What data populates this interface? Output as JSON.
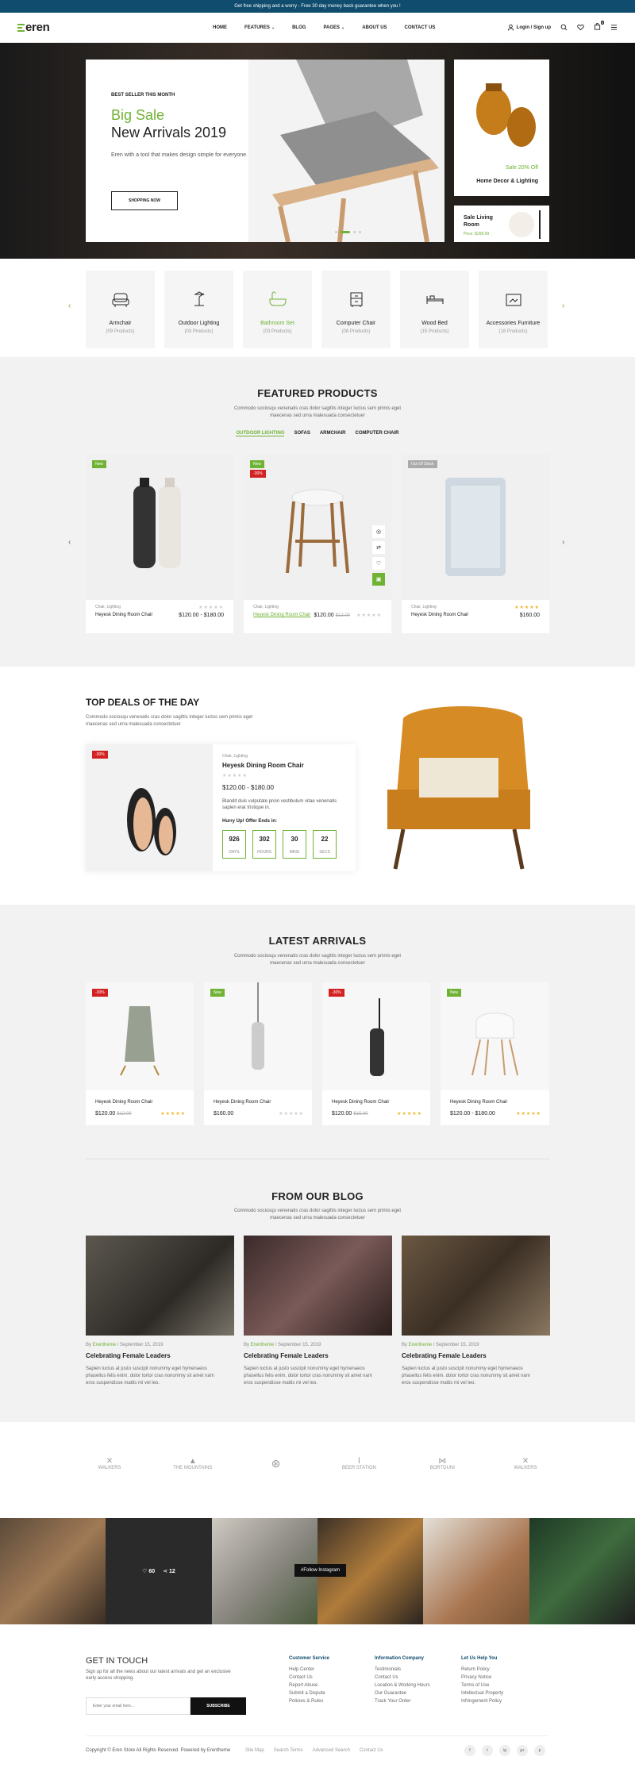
{
  "topbar": {
    "text": "Get free shipping and a worry - Free 30 day money back guarantee when you !"
  },
  "header": {
    "logo": "eren",
    "nav": [
      "HOME",
      "FEATURES",
      "BLOG",
      "PAGES",
      "ABOUT US",
      "CONTACT US"
    ],
    "login": "Login / Sign up",
    "cart_count": "0"
  },
  "hero": {
    "kicker": "BEST SELLER THIS MONTH",
    "title_green": "Big Sale",
    "title_dark": "New Arrivals 2019",
    "desc": "Eren with a tool that makes design simple for everyone.",
    "button": "SHOPPING NOW",
    "side1_sale": "Sale 20% Off",
    "side1_title": "Home Decor & Lighting",
    "side2_title": "Sale Living Room",
    "side2_price": "Price: $299.99"
  },
  "categories": [
    {
      "name": "Armchair",
      "count": "(09 Products)"
    },
    {
      "name": "Outdoor Lighting",
      "count": "(03 Products)"
    },
    {
      "name": "Bathroom Set",
      "count": "(03 Products)"
    },
    {
      "name": "Computer Chair",
      "count": "(08 Products)"
    },
    {
      "name": "Wood Bed",
      "count": "(15 Products)"
    },
    {
      "name": "Accessories Furniture",
      "count": "(18 Products)"
    }
  ],
  "featured": {
    "title": "FEATURED PRODUCTS",
    "desc1": "Commodo sociosqu venenatis cras dolor sagittis integer luctus sem primis eget",
    "desc2": "maecenas sed urna malesuada consectetuer",
    "tabs": [
      "OUTDOOR LIGHTING",
      "SOFAS",
      "ARMCHAIR",
      "COMPUTER CHAIR"
    ],
    "products": [
      {
        "badge": "New",
        "cat": "Chair, Lighting",
        "name": "Heyesk Dining Room Chair",
        "price": "$120.00 - $180.00",
        "old": ""
      },
      {
        "badge": "New",
        "badge2": "-30%",
        "cat": "Chair, Lighting",
        "name": "Heyesk Dining Room Chair",
        "price": "$120.00",
        "old": "$12.00"
      },
      {
        "badge": "Out Of Stock",
        "cat": "Chair, Lighting",
        "name": "Heyesk Dining Room Chair",
        "price": "$160.00",
        "old": ""
      }
    ]
  },
  "deal": {
    "title": "TOP DEALS OF THE DAY",
    "desc1": "Commodo sociosqu venenatis cras dolor sagittis integer luctus sem primis eget",
    "desc2": "maecenas sed urna malesuada consectetuer",
    "badge": "-30%",
    "cat": "Chair, Lighting",
    "name": "Heyesk Dining Room Chair",
    "price": "$120.00 - $180.00",
    "text1": "Blandit duis vulputate proin vestibulum vitae venenatis",
    "text2": "sapien erat tristique in.",
    "hurry": "Hurry Up! Offer Ends in:",
    "cd": [
      {
        "v": "926",
        "l": "DAYS"
      },
      {
        "v": "302",
        "l": "HOURS"
      },
      {
        "v": "30",
        "l": "MINS"
      },
      {
        "v": "22",
        "l": "SECS"
      }
    ]
  },
  "latest": {
    "title": "LATEST ARRIVALS",
    "desc1": "Commodo sociosqu venenatis cras dolor sagittis integer luctus sem primis eget",
    "desc2": "maecenas sed urna malesuada consectetuer",
    "products": [
      {
        "badge": "-30%",
        "name": "Heyesk Dining Room Chair",
        "price": "$120.00",
        "old": "$12.00"
      },
      {
        "badge": "New",
        "name": "Heyesk Dining Room Chair",
        "price": "$160.00",
        "old": ""
      },
      {
        "badge": "-30%",
        "name": "Heyesk Dining Room Chair",
        "price": "$120.00",
        "old": "$15.00"
      },
      {
        "badge": "New",
        "name": "Heyesk Dining Room Chair",
        "price": "$120.00 - $180.00",
        "old": ""
      }
    ]
  },
  "blog": {
    "title": "FROM OUR BLOG",
    "desc1": "Commodo sociosqu venenatis cras dolor sagittis integer luctus sem primis eget",
    "desc2": "maecenas sed urna malesuada consectetuer",
    "by": "By",
    "author": "Erentheme",
    "date": "/ September 15, 2019",
    "post_title": "Celebrating Female Leaders",
    "excerpt1": "Sapien luctus at justo suscipit nonummy eget hymenaeos",
    "excerpt2": "phasellus felis enim. dolor tortor cras nonummy sit amet nam",
    "excerpt3": "eros suspendisse mattis mi vel leo."
  },
  "brands": [
    "WALKERS",
    "THE MOUNTAINS",
    "",
    "BEER STATION",
    "BORTOUNI",
    "WALKERS"
  ],
  "insta": {
    "likes": "60",
    "shares": "12",
    "button": "#Follow Instagram"
  },
  "footer": {
    "get_title": "GET IN TOUCH",
    "get_text1": "Sign up for all the news about our latest arrivals and get an exclusive",
    "get_text2": "early access shopping.",
    "email_ph": "Enter your email here...",
    "subscribe": "SUBSCRIBE",
    "cols": [
      {
        "title": "Customer Service",
        "items": [
          "Help Center",
          "Contact Us",
          "Report Abuse",
          "Submit a Dispute",
          "Policies & Rules"
        ]
      },
      {
        "title": "Information Company",
        "items": [
          "Testimonials",
          "Contact Us",
          "Location & Working Hours",
          "Our Guarantee",
          "Track Your Order"
        ]
      },
      {
        "title": "Let Us Help You",
        "items": [
          "Return Policy",
          "Privacy Notice",
          "Terms of Use",
          "Intellectual Property",
          "Infringement Policy"
        ]
      }
    ],
    "copyright": "Copyright © Eren Store All Rights Reserved. Powered by Erentheme",
    "links": [
      "Site Map",
      "Search Terms",
      "Advanced Search",
      "Contact Us"
    ],
    "social": [
      "f",
      "t",
      "ig",
      "g+",
      "p"
    ]
  },
  "colors": {
    "accent": "#6fb234",
    "topbar": "#0f4c6e",
    "sale": "#d32222"
  }
}
